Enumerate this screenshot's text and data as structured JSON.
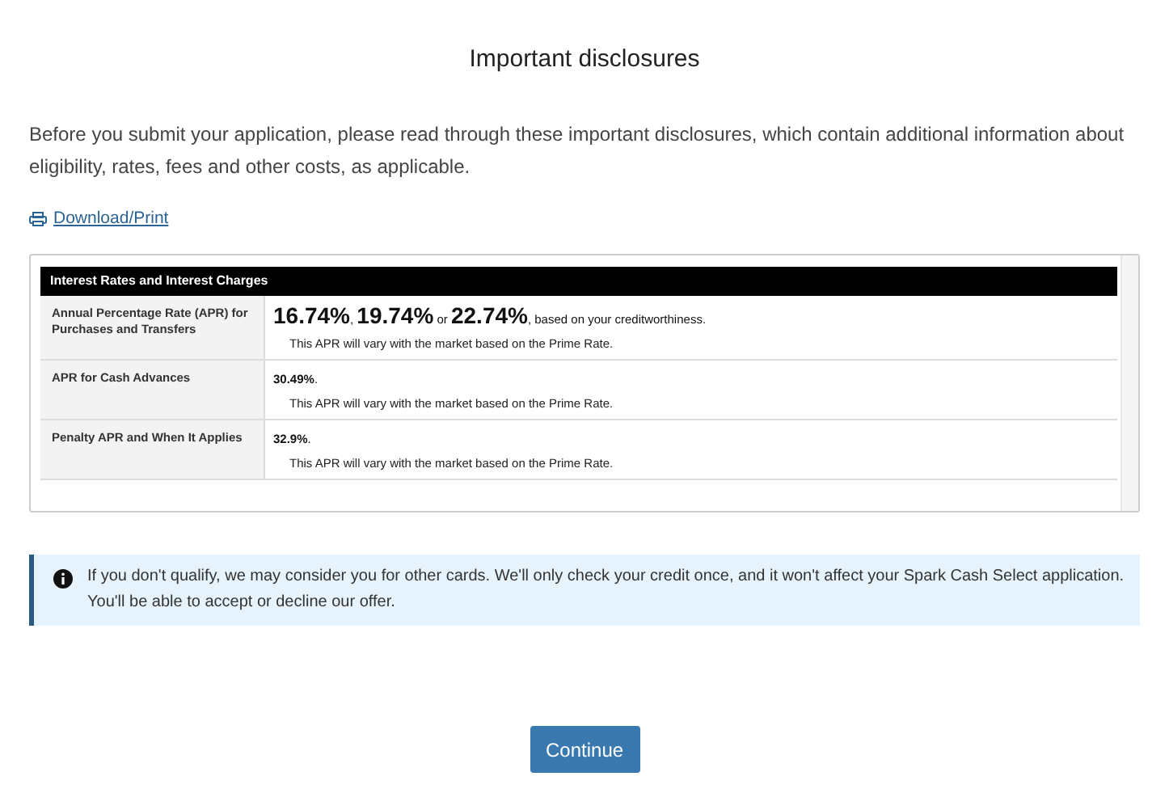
{
  "title": "Important disclosures",
  "intro": "Before you submit your application, please read through these important disclosures, which contain additional information about eligibility, rates, fees and other costs, as applicable.",
  "download_link": "Download/Print",
  "table": {
    "header": "Interest Rates and Interest Charges",
    "rows": [
      {
        "label": "Annual Percentage Rate (APR) for Purchases and Transfers",
        "value_parts": [
          {
            "kind": "rate",
            "text": "16.74%"
          },
          {
            "kind": "plain",
            "text": ", "
          },
          {
            "kind": "rate",
            "text": "19.74%"
          },
          {
            "kind": "plain",
            "text": " or "
          },
          {
            "kind": "rate",
            "text": "22.74%"
          },
          {
            "kind": "plain",
            "text": ", based on your creditworthiness."
          }
        ],
        "note": "This APR will vary with the market based on the Prime Rate."
      },
      {
        "label": "APR for Cash Advances",
        "value_parts": [
          {
            "kind": "strong",
            "text": "30.49%"
          },
          {
            "kind": "plain",
            "text": "."
          }
        ],
        "note": "This APR will vary with the market based on the Prime Rate."
      },
      {
        "label": "Penalty APR and When It Applies",
        "value_parts": [
          {
            "kind": "strong",
            "text": "32.9%"
          },
          {
            "kind": "plain",
            "text": "."
          }
        ],
        "note": "This APR will vary with the market based on the Prime Rate."
      }
    ]
  },
  "notice": "If you don't qualify, we may consider you for other cards. We'll only check your credit once, and it won't affect your Spark Cash Select application. You'll be able to accept or decline our offer.",
  "continue_button": "Continue"
}
